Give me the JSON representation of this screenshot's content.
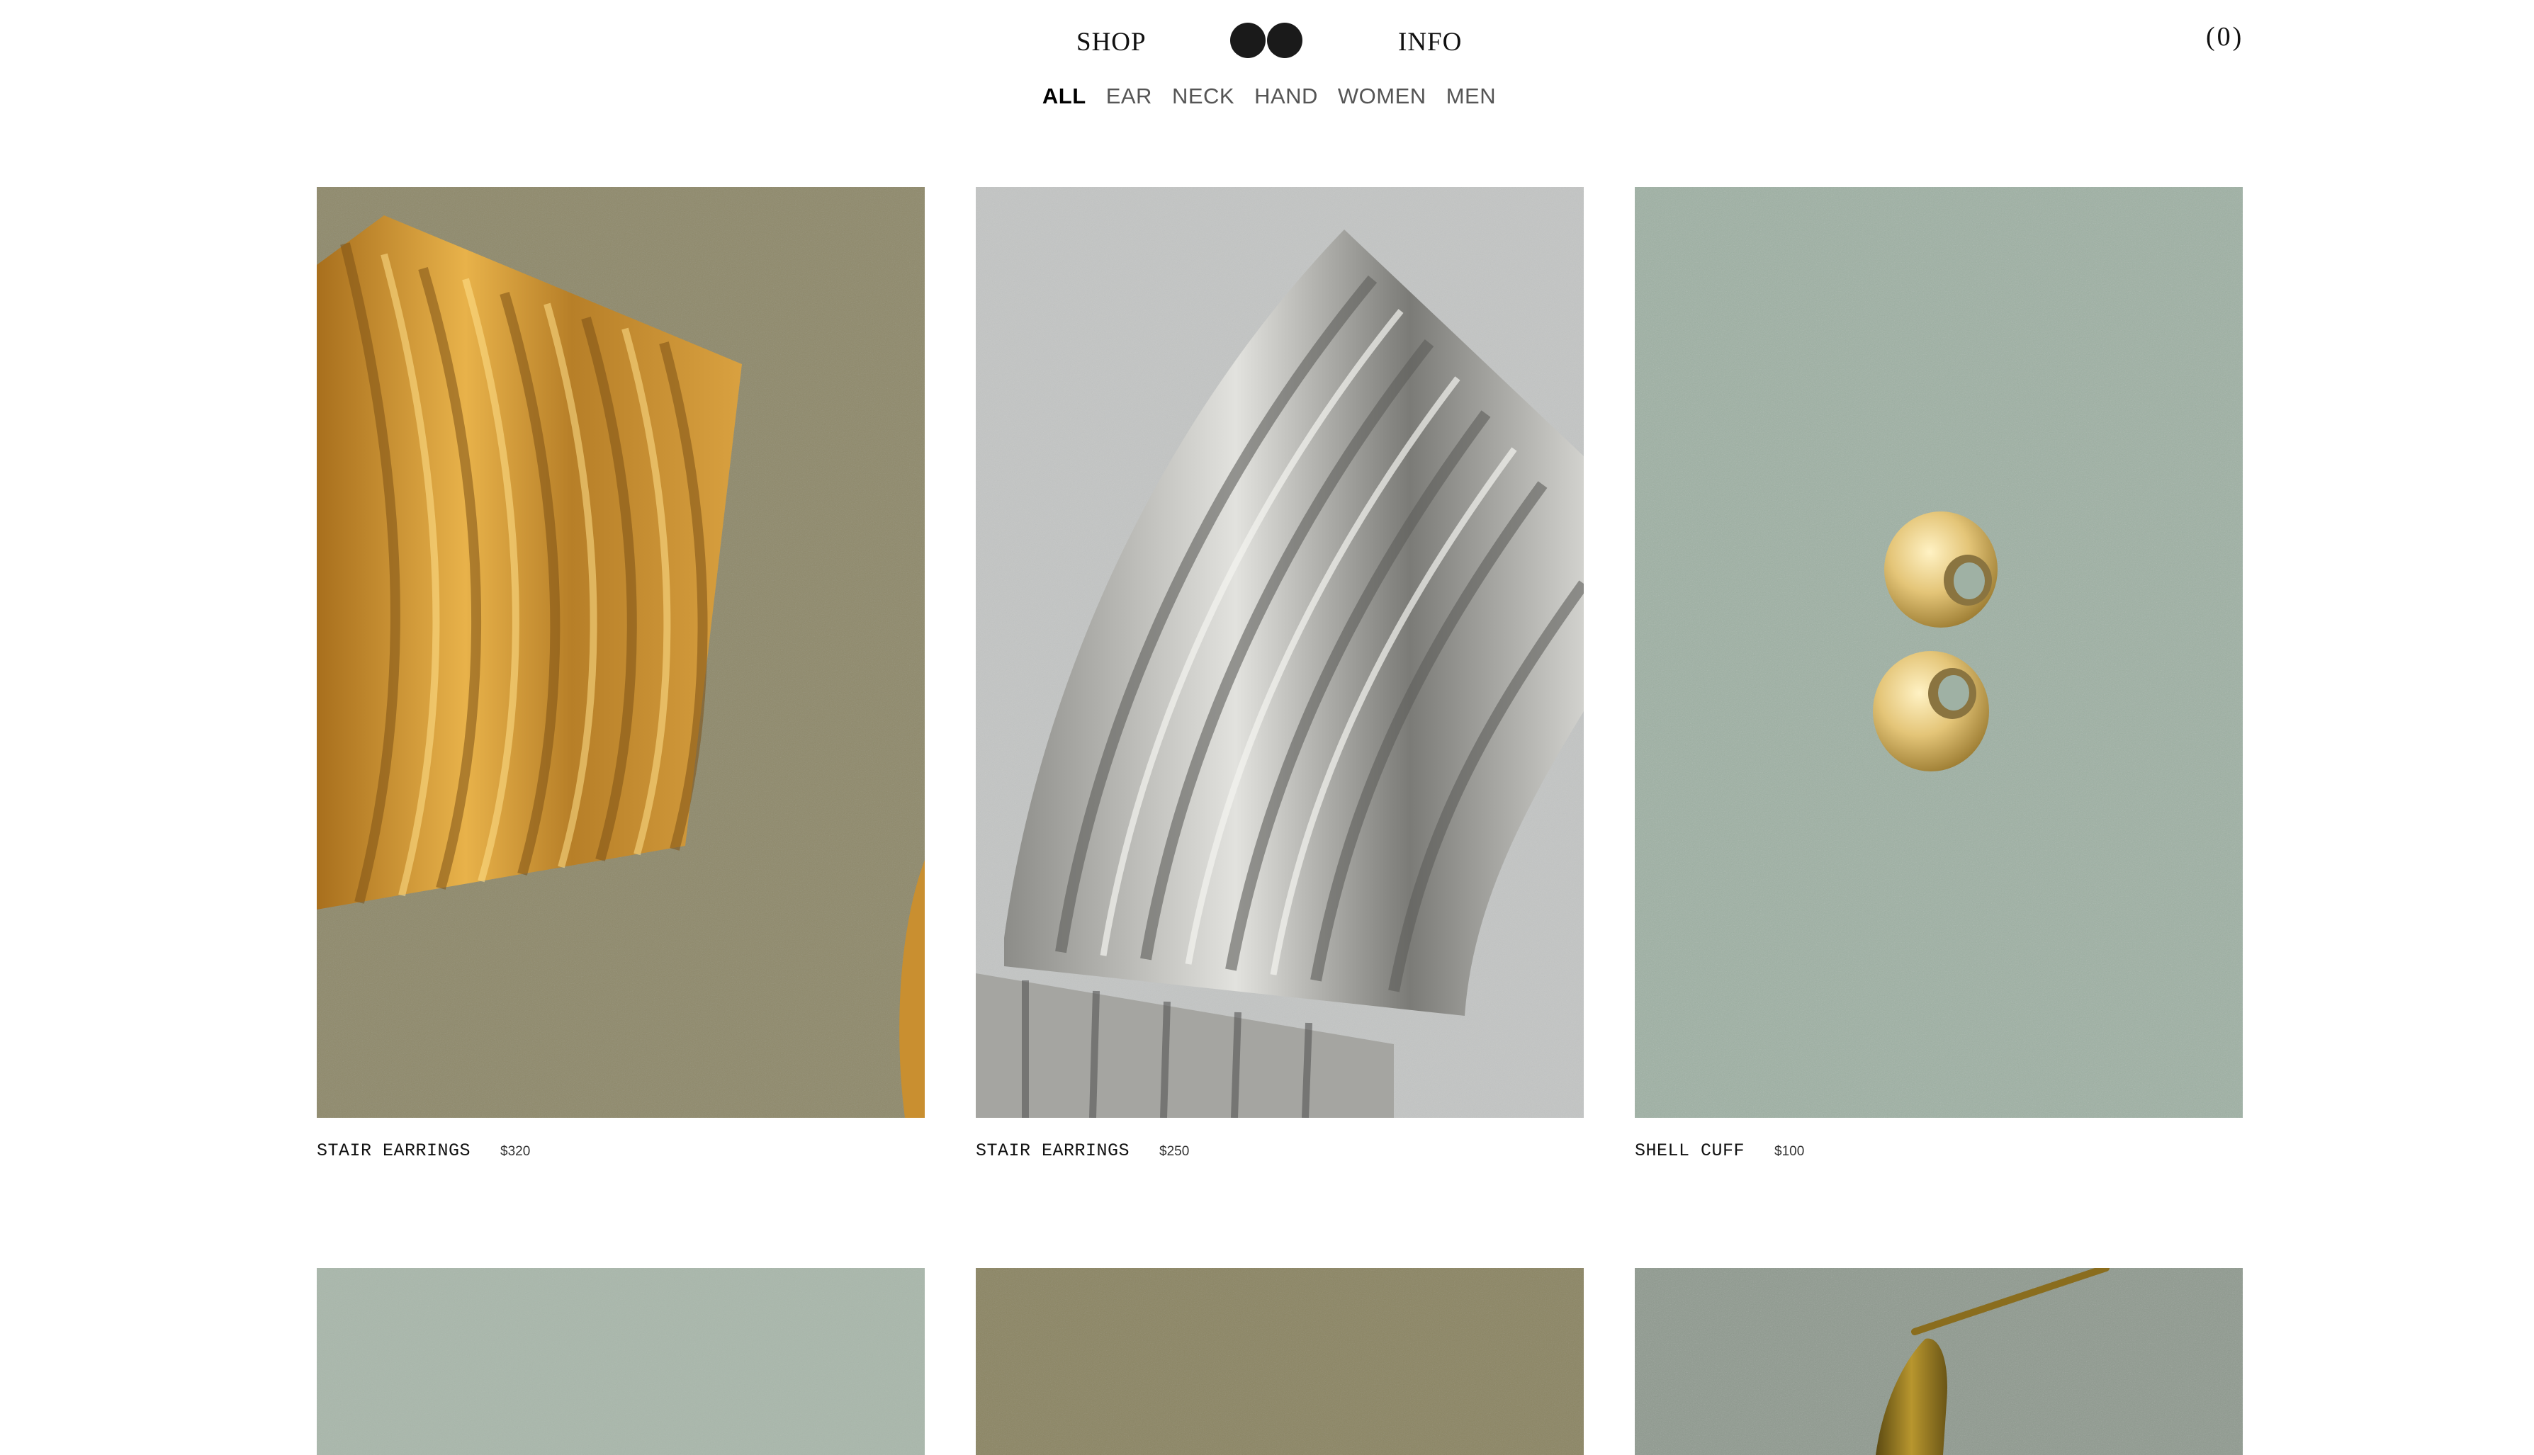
{
  "header": {
    "shop_label": "SHOP",
    "info_label": "INFO",
    "logo_icon": "double-circle-logo-icon",
    "cart_label": "(0)"
  },
  "filters": [
    {
      "label": "ALL",
      "active": true
    },
    {
      "label": "EAR",
      "active": false
    },
    {
      "label": "NECK",
      "active": false
    },
    {
      "label": "HAND",
      "active": false
    },
    {
      "label": "WOMEN",
      "active": false
    },
    {
      "label": "MEN",
      "active": false
    }
  ],
  "products": [
    {
      "name": "STAIR EARRINGS",
      "price": "$320",
      "background": "#8f8a6b",
      "metal": "gold"
    },
    {
      "name": "STAIR EARRINGS",
      "price": "$250",
      "background": "#c3c5c4",
      "metal": "silver"
    },
    {
      "name": "SHELL CUFF",
      "price": "$100",
      "background": "#9fb1a4",
      "metal": "gold"
    },
    {
      "background": "#a9b7ab"
    },
    {
      "background": "#8c8663"
    },
    {
      "background": "#8f9a8f"
    }
  ],
  "colors": {
    "text": "#111111",
    "muted": "#555555",
    "page_bg": "#ffffff"
  }
}
